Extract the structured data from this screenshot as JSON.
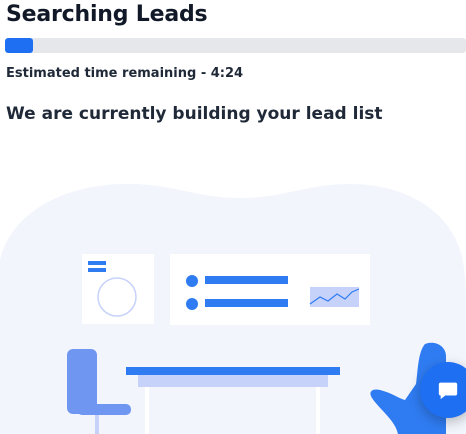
{
  "header": {
    "title": "Searching Leads"
  },
  "progress": {
    "fraction": 0.06,
    "track_color": "#e5e7eb",
    "fill_color": "#1e6ff2"
  },
  "status": {
    "time_remaining": "Estimated time remaining - 4:24",
    "message": "We are currently building your lead list"
  },
  "illustration": {
    "icon": "office-desk-illustration",
    "colors": {
      "background_blob": "#f3f5fd",
      "card": "#ffffff",
      "primary": "#2f7cf2",
      "light": "#c7d2fb",
      "chair": "#6f97f2"
    }
  },
  "chat_widget": {
    "icon": "chat-bubble-icon",
    "color": "#1e6ff2"
  }
}
